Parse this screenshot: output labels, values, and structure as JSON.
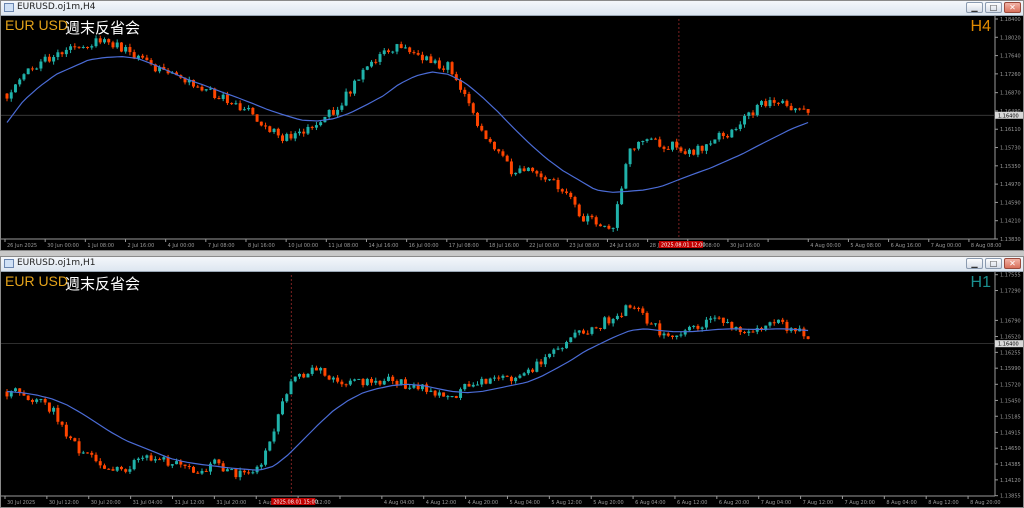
{
  "colors": {
    "bg": "#000000",
    "bull": "#20b2aa",
    "bear": "#ff4500",
    "ma": "#4b6cd6",
    "grid": "#3a3a3a",
    "axis": "#9a9a9a",
    "symbol": "#e3a21a",
    "tf_h4": "#e08a00",
    "tf_h1": "#1a8f8f",
    "current_label": "#c00000"
  },
  "window_controls": {
    "minimize": "▁",
    "maximize": "□",
    "close": "✕"
  },
  "chart_data": [
    {
      "type": "candlestick",
      "window_title": "EURUSD.oj1m,H4",
      "symbol": "EUR USD",
      "annotation": "週末反省会",
      "timeframe": "H4",
      "current_price": "1.16400",
      "current_time": "2025.08.01 12:00",
      "price_ticks": [
        "1.18400",
        "1.18020",
        "1.17640",
        "1.17260",
        "1.16870",
        "1.16490",
        "1.16110",
        "1.15730",
        "1.15350",
        "1.14970",
        "1.14590",
        "1.14210",
        "1.13830"
      ],
      "ylim": [
        1.1383,
        1.184
      ],
      "time_labels": [
        "26 Jun 2025",
        "30 Jun 00:00",
        "1 Jul 08:00",
        "2 Jul 16:00",
        "4 Jul 00:00",
        "7 Jul 08:00",
        "8 Jul 16:00",
        "10 Jul 00:00",
        "11 Jul 08:00",
        "14 Jul 16:00",
        "16 Jul 00:00",
        "17 Jul 08:00",
        "18 Jul 16:00",
        "22 Jul 00:00",
        "23 Jul 08:00",
        "24 Jul 16:00",
        "28 Jul 00:00",
        "29 Jul 08:00",
        "30 Jul 16:00",
        "",
        "4 Aug 00:00",
        "5 Aug 08:00",
        "6 Aug 16:00",
        "7 Aug 00:00",
        "8 Aug 08:00"
      ],
      "close_path": [
        1.1685,
        1.1725,
        1.1748,
        1.1765,
        1.1782,
        1.179,
        1.1795,
        1.178,
        1.1762,
        1.174,
        1.1722,
        1.1708,
        1.1695,
        1.168,
        1.1665,
        1.164,
        1.1615,
        1.159,
        1.1605,
        1.1628,
        1.1652,
        1.169,
        1.1735,
        1.1765,
        1.178,
        1.177,
        1.1752,
        1.174,
        1.169,
        1.161,
        1.156,
        1.152,
        1.153,
        1.151,
        1.149,
        1.143,
        1.1415,
        1.14,
        1.1565,
        1.159,
        1.158,
        1.1575,
        1.156,
        1.159,
        1.16,
        1.1625,
        1.1665,
        1.167,
        1.1655,
        1.164
      ],
      "ma_path": [
        1.1625,
        1.167,
        1.17,
        1.1725,
        1.174,
        1.1755,
        1.176,
        1.1762,
        1.1758,
        1.1745,
        1.173,
        1.1715,
        1.1703,
        1.169,
        1.1678,
        1.1665,
        1.1651,
        1.164,
        1.163,
        1.1628,
        1.1633,
        1.1645,
        1.1662,
        1.168,
        1.1705,
        1.1722,
        1.173,
        1.1725,
        1.1708,
        1.168,
        1.1648,
        1.1613,
        1.158,
        1.155,
        1.1525,
        1.1505,
        1.1485,
        1.148,
        1.1482,
        1.1485,
        1.1492,
        1.1505,
        1.1518,
        1.153,
        1.1545,
        1.156,
        1.1578,
        1.1595,
        1.1612,
        1.1625
      ]
    },
    {
      "type": "candlestick",
      "window_title": "EURUSD.oj1m,H1",
      "symbol": "EUR USD",
      "annotation": "週末反省会",
      "timeframe": "H1",
      "current_price": "1.16400",
      "current_time": "2025.08.01 15:00",
      "price_ticks": [
        "1.17555",
        "1.17290",
        "1.16790",
        "1.16520",
        "1.16255",
        "1.15990",
        "1.15720",
        "1.15450",
        "1.15185",
        "1.14915",
        "1.14650",
        "1.14385",
        "1.14120",
        "1.13855"
      ],
      "ylim": [
        1.1385,
        1.1755
      ],
      "time_labels": [
        "30 Jul 2025",
        "30 Jul 12:00",
        "30 Jul 20:00",
        "31 Jul 04:00",
        "31 Jul 12:00",
        "31 Jul 20:00",
        "1 Aug 04:00",
        "1 Aug 12:00",
        "",
        "4 Aug 04:00",
        "4 Aug 12:00",
        "4 Aug 20:00",
        "5 Aug 04:00",
        "5 Aug 12:00",
        "5 Aug 20:00",
        "6 Aug 04:00",
        "6 Aug 12:00",
        "6 Aug 20:00",
        "7 Aug 04:00",
        "7 Aug 12:00",
        "7 Aug 20:00",
        "8 Aug 04:00",
        "8 Aug 12:00",
        "8 Aug 20:00"
      ],
      "close_path": [
        1.156,
        1.1555,
        1.1548,
        1.153,
        1.149,
        1.146,
        1.144,
        1.1422,
        1.143,
        1.1445,
        1.1455,
        1.144,
        1.1432,
        1.1428,
        1.144,
        1.1425,
        1.1418,
        1.143,
        1.15,
        1.157,
        1.159,
        1.1598,
        1.158,
        1.157,
        1.1575,
        1.158,
        1.1575,
        1.1572,
        1.1565,
        1.1555,
        1.1548,
        1.157,
        1.1575,
        1.1578,
        1.1582,
        1.159,
        1.161,
        1.163,
        1.165,
        1.166,
        1.1672,
        1.169,
        1.17,
        1.1685,
        1.166,
        1.165,
        1.1665,
        1.1675,
        1.168,
        1.167,
        1.166,
        1.1668,
        1.1672,
        1.1663,
        1.1655
      ],
      "ma_path": [
        1.156,
        1.1558,
        1.1554,
        1.1548,
        1.1538,
        1.1524,
        1.1508,
        1.1492,
        1.1478,
        1.1468,
        1.1458,
        1.1448,
        1.1442,
        1.1438,
        1.1435,
        1.1432,
        1.143,
        1.1428,
        1.1435,
        1.1455,
        1.148,
        1.1505,
        1.1528,
        1.1545,
        1.1558,
        1.1565,
        1.157,
        1.1572,
        1.157,
        1.1565,
        1.156,
        1.1558,
        1.156,
        1.1565,
        1.157,
        1.1575,
        1.1585,
        1.1598,
        1.1612,
        1.1628,
        1.164,
        1.1652,
        1.1662,
        1.1665,
        1.1662,
        1.166,
        1.166,
        1.1662,
        1.1664,
        1.1665,
        1.1664,
        1.1664,
        1.1665,
        1.1664,
        1.1662
      ]
    }
  ]
}
